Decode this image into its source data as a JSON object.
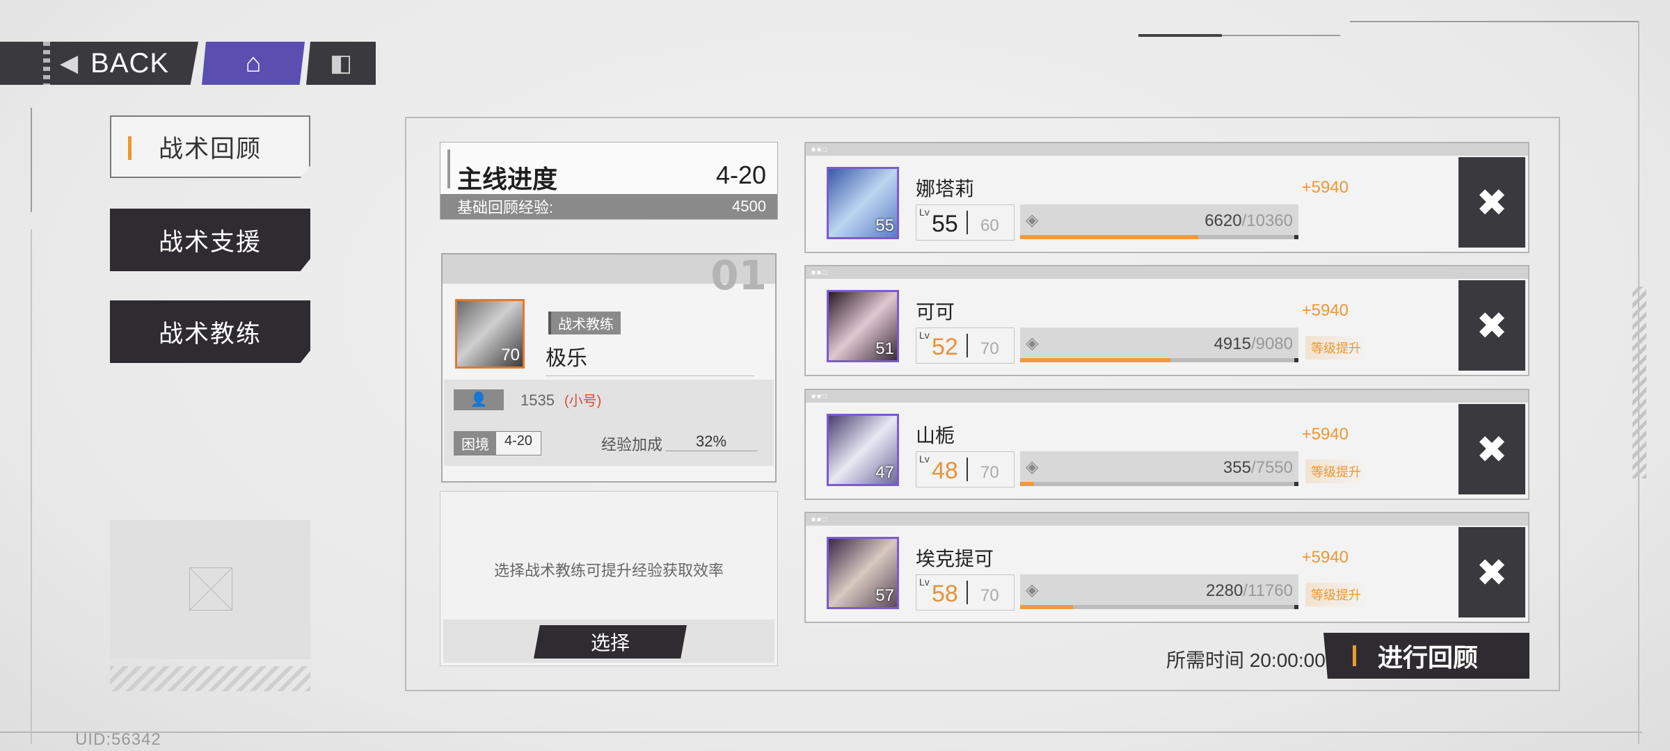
{
  "topbar": {
    "back_label": "BACK",
    "home_icon": "home-icon",
    "info_icon": "info-icon"
  },
  "nav": {
    "items": [
      {
        "label": "战术回顾",
        "active": true
      },
      {
        "label": "战术支援",
        "active": false
      },
      {
        "label": "战术教练",
        "active": false
      }
    ]
  },
  "uid": "UID:56342",
  "progress": {
    "title": "主线进度",
    "stage": "4-20",
    "base_label": "基础回顾经验:",
    "base_value": "4500"
  },
  "coach": {
    "slot": "01",
    "role": "战术教练",
    "name": "极乐",
    "level": "70",
    "uid": "1535",
    "alt_tag": "(小号)",
    "difficulty_label": "困境",
    "difficulty_value": "4-20",
    "bonus_label": "经验加成",
    "bonus_value": "32%"
  },
  "select_card": {
    "hint": "选择战术教练可提升经验获取效率",
    "button": "选择"
  },
  "characters": [
    {
      "name": "娜塔莉",
      "portrait_level": "55",
      "gain": "+5940",
      "lv_label": "Lv",
      "level": "55",
      "max_level": "60",
      "exp": "6620",
      "exp_max": "/10360",
      "exp_fraction": 0.64,
      "level_up": "",
      "remove_icon": "close-icon"
    },
    {
      "name": "可可",
      "portrait_level": "51",
      "gain": "+5940",
      "lv_label": "Lv",
      "level": "52",
      "max_level": "70",
      "exp": "4915",
      "exp_max": "/9080",
      "exp_fraction": 0.54,
      "level_up": "等级提升",
      "remove_icon": "close-icon"
    },
    {
      "name": "山栀",
      "portrait_level": "47",
      "gain": "+5940",
      "lv_label": "Lv",
      "level": "48",
      "max_level": "70",
      "exp": "355",
      "exp_max": "/7550",
      "exp_fraction": 0.05,
      "level_up": "等级提升",
      "remove_icon": "close-icon"
    },
    {
      "name": "埃克提可",
      "portrait_level": "57",
      "gain": "+5940",
      "lv_label": "Lv",
      "level": "58",
      "max_level": "70",
      "exp": "2280",
      "exp_max": "/11760",
      "exp_fraction": 0.19,
      "level_up": "等级提升",
      "remove_icon": "close-icon"
    }
  ],
  "footer": {
    "time": "所需时间 20:00:00",
    "go_label": "进行回顾"
  },
  "colors": {
    "accent": "#f0962e",
    "home": "#5a4fb0",
    "dark": "#2e2c30",
    "portrait_border": "#7a5bd0"
  }
}
